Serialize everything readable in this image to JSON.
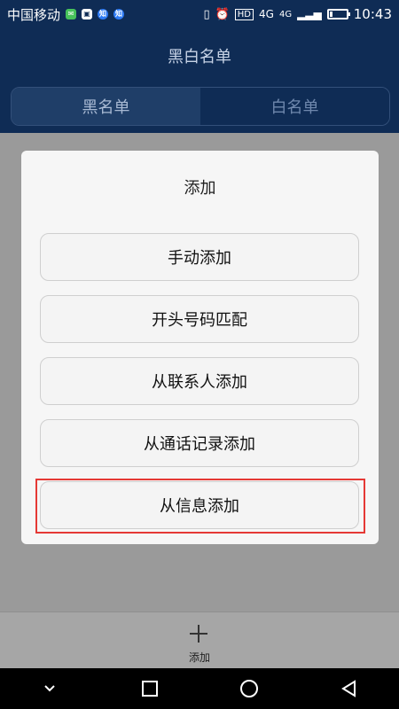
{
  "status_bar": {
    "carrier": "中国移动",
    "network": "4G",
    "network2": "4G",
    "time": "10:43"
  },
  "header": {
    "title": "黑白名单",
    "tabs": [
      {
        "label": "黑名单",
        "active": true
      },
      {
        "label": "白名单",
        "active": false
      }
    ]
  },
  "dialog": {
    "title": "添加",
    "options": [
      {
        "label": "手动添加"
      },
      {
        "label": "开头号码匹配"
      },
      {
        "label": "从联系人添加"
      },
      {
        "label": "从通话记录添加"
      },
      {
        "label": "从信息添加",
        "highlighted": true
      }
    ]
  },
  "bottom_bar": {
    "add_label": "添加",
    "icon": "plus-icon"
  },
  "nav_bar": {
    "icons": [
      "chevron-down-icon",
      "square-icon",
      "circle-icon",
      "triangle-back-icon"
    ]
  },
  "colors": {
    "header_bg": "#0f2c55",
    "overlay": "#9a9a9a",
    "dialog_bg": "#f6f6f6",
    "highlight": "#e53935"
  }
}
